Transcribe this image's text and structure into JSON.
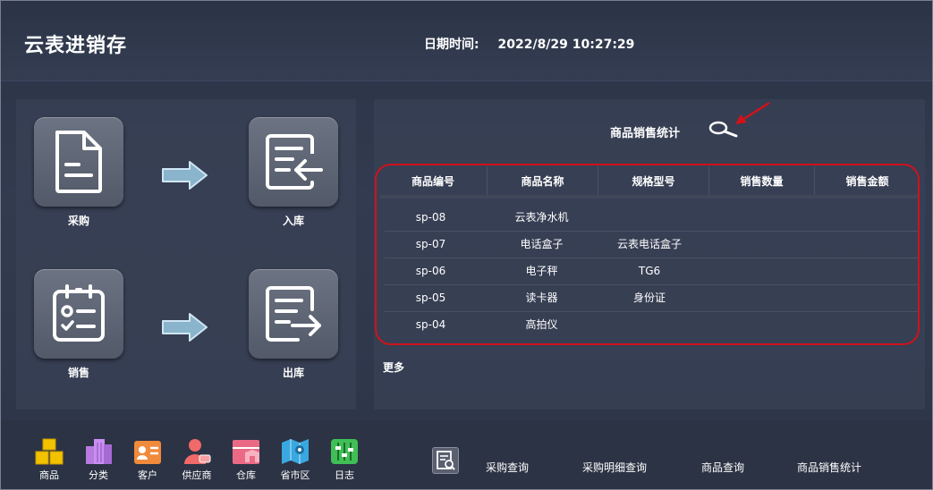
{
  "header": {
    "app_title": "云表进销存",
    "datetime_label": "日期时间:",
    "datetime_value": "2022/8/29 10:27:29"
  },
  "flow": {
    "purchase_label": "采购",
    "inbound_label": "入库",
    "sales_label": "销售",
    "outbound_label": "出库"
  },
  "stats": {
    "title": "商品销售统计",
    "columns": [
      "商品编号",
      "商品名称",
      "规格型号",
      "销售数量",
      "销售金额"
    ],
    "rows": [
      [
        "sp-08",
        "云表净水机",
        "",
        "",
        ""
      ],
      [
        "sp-07",
        "电话盒子",
        "云表电话盒子",
        "",
        ""
      ],
      [
        "sp-06",
        "电子秤",
        "TG6",
        "",
        ""
      ],
      [
        "sp-05",
        "读卡器",
        "身份证",
        "",
        ""
      ],
      [
        "sp-04",
        "高拍仪",
        "",
        "",
        ""
      ]
    ],
    "more_label": "更多"
  },
  "quick_nav": [
    {
      "label": "商品",
      "icon": "goods-boxes-icon",
      "color": "#f2c200"
    },
    {
      "label": "分类",
      "icon": "category-buildings-icon",
      "color": "#b77be0"
    },
    {
      "label": "客户",
      "icon": "customer-card-icon",
      "color": "#f08a3c"
    },
    {
      "label": "供应商",
      "icon": "supplier-person-icon",
      "color": "#f06a6a"
    },
    {
      "label": "仓库",
      "icon": "warehouse-icon",
      "color": "#ea6a86"
    },
    {
      "label": "省市区",
      "icon": "region-map-icon",
      "color": "#3aa8e0"
    },
    {
      "label": "日志",
      "icon": "log-sliders-icon",
      "color": "#3fbf55"
    }
  ],
  "queries": [
    "采购查询",
    "采购明细查询",
    "商品查询",
    "商品销售统计"
  ],
  "colors": {
    "annotation_red": "#d0121b"
  }
}
